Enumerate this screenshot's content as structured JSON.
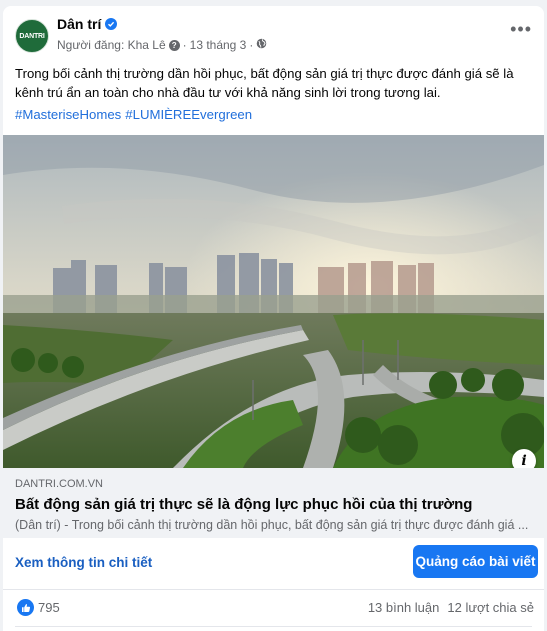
{
  "post": {
    "page_name": "Dân trí",
    "avatar_text": "DANTRI",
    "posted_by": "Người đăng: Kha Lê",
    "date": "13 tháng 3",
    "separator": "·",
    "text": "Trong bối cảnh thị trường dần hồi phục, bất động sản giá trị thực được đánh giá sẽ là kênh trú ẩn an toàn cho nhà đầu tư với khả năng sinh lời trong tương lai.",
    "hashtags": [
      "#MasteriseHomes",
      "#LUMIÈREEvergreen"
    ],
    "more_label": "•••"
  },
  "link_preview": {
    "domain": "DANTRI.COM.VN",
    "title": "Bất động sản giá trị thực sẽ là động lực phục hồi của thị trường",
    "description": "(Dân trí) - Trong bối cảnh thị trường dần hồi phục, bất động sản giá trị thực được đánh giá ...",
    "info_label": "i"
  },
  "actions": {
    "details_link": "Xem thông tin chi tiết",
    "promote_button": "Quảng cáo bài viết"
  },
  "stats": {
    "reactions": "795",
    "comments": "13 bình luận",
    "shares": "12 lượt chia sẻ"
  },
  "colors": {
    "accent": "#1877f2",
    "link": "#216fdb",
    "secondary_text": "#65676b"
  },
  "icons": [
    "verified-icon",
    "info-icon",
    "globe-icon",
    "more-icon",
    "like-icon"
  ]
}
